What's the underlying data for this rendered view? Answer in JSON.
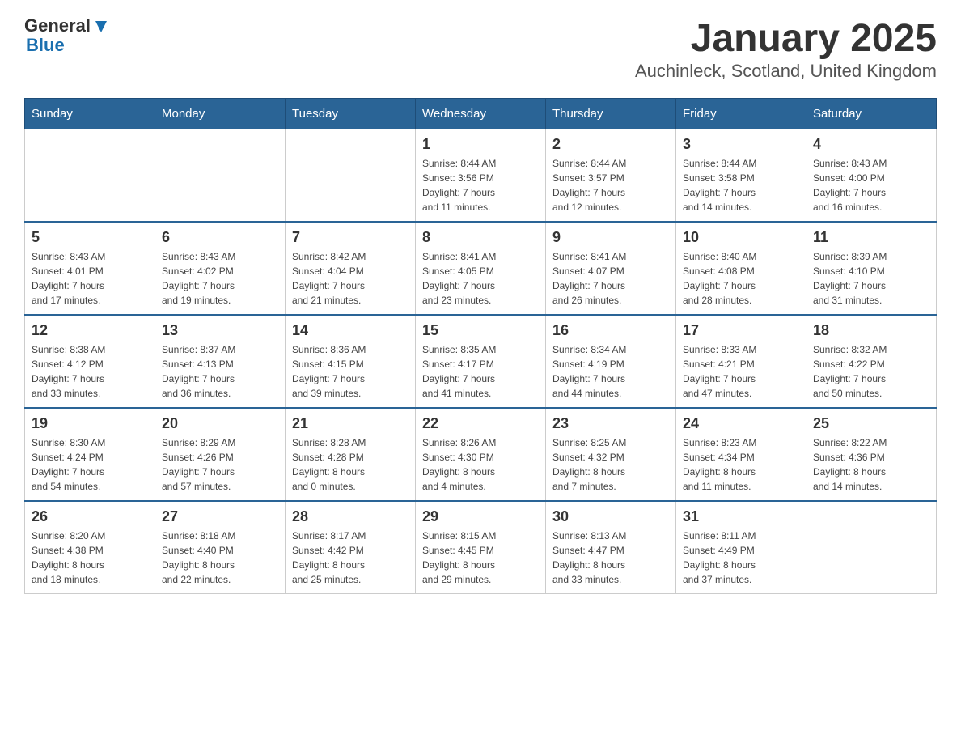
{
  "header": {
    "logo_general": "General",
    "logo_blue": "Blue",
    "month_year": "January 2025",
    "location": "Auchinleck, Scotland, United Kingdom"
  },
  "days_of_week": [
    "Sunday",
    "Monday",
    "Tuesday",
    "Wednesday",
    "Thursday",
    "Friday",
    "Saturday"
  ],
  "weeks": [
    [
      {
        "day": "",
        "info": ""
      },
      {
        "day": "",
        "info": ""
      },
      {
        "day": "",
        "info": ""
      },
      {
        "day": "1",
        "info": "Sunrise: 8:44 AM\nSunset: 3:56 PM\nDaylight: 7 hours\nand 11 minutes."
      },
      {
        "day": "2",
        "info": "Sunrise: 8:44 AM\nSunset: 3:57 PM\nDaylight: 7 hours\nand 12 minutes."
      },
      {
        "day": "3",
        "info": "Sunrise: 8:44 AM\nSunset: 3:58 PM\nDaylight: 7 hours\nand 14 minutes."
      },
      {
        "day": "4",
        "info": "Sunrise: 8:43 AM\nSunset: 4:00 PM\nDaylight: 7 hours\nand 16 minutes."
      }
    ],
    [
      {
        "day": "5",
        "info": "Sunrise: 8:43 AM\nSunset: 4:01 PM\nDaylight: 7 hours\nand 17 minutes."
      },
      {
        "day": "6",
        "info": "Sunrise: 8:43 AM\nSunset: 4:02 PM\nDaylight: 7 hours\nand 19 minutes."
      },
      {
        "day": "7",
        "info": "Sunrise: 8:42 AM\nSunset: 4:04 PM\nDaylight: 7 hours\nand 21 minutes."
      },
      {
        "day": "8",
        "info": "Sunrise: 8:41 AM\nSunset: 4:05 PM\nDaylight: 7 hours\nand 23 minutes."
      },
      {
        "day": "9",
        "info": "Sunrise: 8:41 AM\nSunset: 4:07 PM\nDaylight: 7 hours\nand 26 minutes."
      },
      {
        "day": "10",
        "info": "Sunrise: 8:40 AM\nSunset: 4:08 PM\nDaylight: 7 hours\nand 28 minutes."
      },
      {
        "day": "11",
        "info": "Sunrise: 8:39 AM\nSunset: 4:10 PM\nDaylight: 7 hours\nand 31 minutes."
      }
    ],
    [
      {
        "day": "12",
        "info": "Sunrise: 8:38 AM\nSunset: 4:12 PM\nDaylight: 7 hours\nand 33 minutes."
      },
      {
        "day": "13",
        "info": "Sunrise: 8:37 AM\nSunset: 4:13 PM\nDaylight: 7 hours\nand 36 minutes."
      },
      {
        "day": "14",
        "info": "Sunrise: 8:36 AM\nSunset: 4:15 PM\nDaylight: 7 hours\nand 39 minutes."
      },
      {
        "day": "15",
        "info": "Sunrise: 8:35 AM\nSunset: 4:17 PM\nDaylight: 7 hours\nand 41 minutes."
      },
      {
        "day": "16",
        "info": "Sunrise: 8:34 AM\nSunset: 4:19 PM\nDaylight: 7 hours\nand 44 minutes."
      },
      {
        "day": "17",
        "info": "Sunrise: 8:33 AM\nSunset: 4:21 PM\nDaylight: 7 hours\nand 47 minutes."
      },
      {
        "day": "18",
        "info": "Sunrise: 8:32 AM\nSunset: 4:22 PM\nDaylight: 7 hours\nand 50 minutes."
      }
    ],
    [
      {
        "day": "19",
        "info": "Sunrise: 8:30 AM\nSunset: 4:24 PM\nDaylight: 7 hours\nand 54 minutes."
      },
      {
        "day": "20",
        "info": "Sunrise: 8:29 AM\nSunset: 4:26 PM\nDaylight: 7 hours\nand 57 minutes."
      },
      {
        "day": "21",
        "info": "Sunrise: 8:28 AM\nSunset: 4:28 PM\nDaylight: 8 hours\nand 0 minutes."
      },
      {
        "day": "22",
        "info": "Sunrise: 8:26 AM\nSunset: 4:30 PM\nDaylight: 8 hours\nand 4 minutes."
      },
      {
        "day": "23",
        "info": "Sunrise: 8:25 AM\nSunset: 4:32 PM\nDaylight: 8 hours\nand 7 minutes."
      },
      {
        "day": "24",
        "info": "Sunrise: 8:23 AM\nSunset: 4:34 PM\nDaylight: 8 hours\nand 11 minutes."
      },
      {
        "day": "25",
        "info": "Sunrise: 8:22 AM\nSunset: 4:36 PM\nDaylight: 8 hours\nand 14 minutes."
      }
    ],
    [
      {
        "day": "26",
        "info": "Sunrise: 8:20 AM\nSunset: 4:38 PM\nDaylight: 8 hours\nand 18 minutes."
      },
      {
        "day": "27",
        "info": "Sunrise: 8:18 AM\nSunset: 4:40 PM\nDaylight: 8 hours\nand 22 minutes."
      },
      {
        "day": "28",
        "info": "Sunrise: 8:17 AM\nSunset: 4:42 PM\nDaylight: 8 hours\nand 25 minutes."
      },
      {
        "day": "29",
        "info": "Sunrise: 8:15 AM\nSunset: 4:45 PM\nDaylight: 8 hours\nand 29 minutes."
      },
      {
        "day": "30",
        "info": "Sunrise: 8:13 AM\nSunset: 4:47 PM\nDaylight: 8 hours\nand 33 minutes."
      },
      {
        "day": "31",
        "info": "Sunrise: 8:11 AM\nSunset: 4:49 PM\nDaylight: 8 hours\nand 37 minutes."
      },
      {
        "day": "",
        "info": ""
      }
    ]
  ]
}
